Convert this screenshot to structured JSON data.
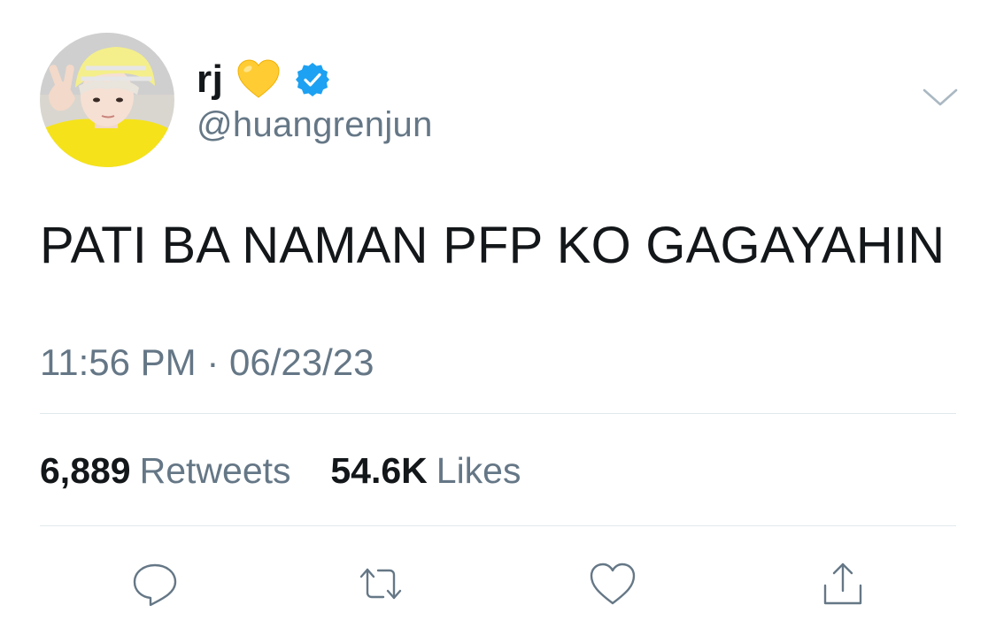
{
  "author": {
    "display_name": "rj",
    "handle": "@huangrenjun",
    "name_emoji": "yellow-heart",
    "verified": true
  },
  "tweet": {
    "text": "PATI BA NAMAN PFP KO GAGAYAHIN",
    "timestamp": "11:56 PM · 06/23/23"
  },
  "stats": {
    "retweets_count": "6,889",
    "retweets_label": "Retweets",
    "likes_count": "54.6K",
    "likes_label": "Likes"
  },
  "actions": [
    {
      "icon": "reply-icon"
    },
    {
      "icon": "retweet-icon"
    },
    {
      "icon": "like-heart-icon"
    },
    {
      "icon": "share-icon"
    }
  ],
  "colors": {
    "text_primary": "#14171a",
    "text_secondary": "#657786",
    "verified_blue": "#1da1f2",
    "divider": "#e1e8ed",
    "emoji_yellow": "#ffcc33"
  }
}
